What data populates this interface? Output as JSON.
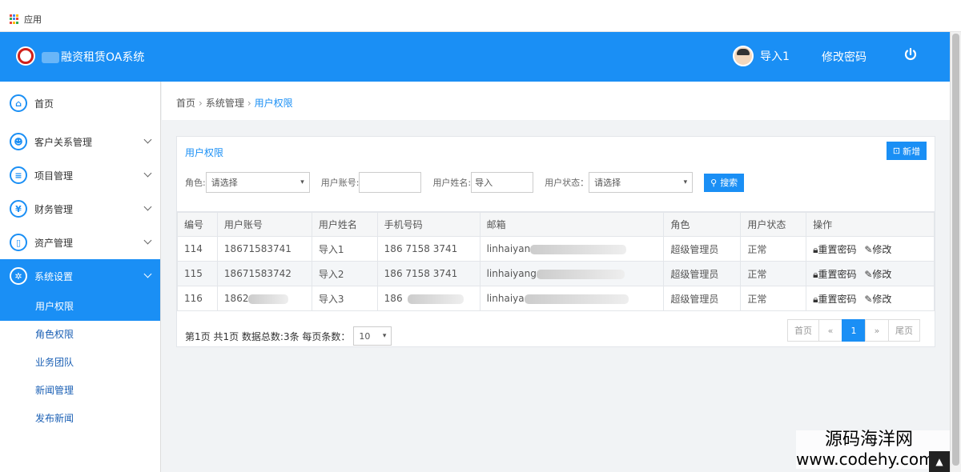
{
  "browser": {
    "apps_label": "应用"
  },
  "header": {
    "title": "融资租赁OA系统",
    "user_name": "导入1",
    "change_password": "修改密码"
  },
  "sidebar": {
    "items": [
      {
        "label": "首页",
        "icon": "home-icon"
      },
      {
        "label": "客户关系管理",
        "icon": "users-icon"
      },
      {
        "label": "项目管理",
        "icon": "list-icon"
      },
      {
        "label": "财务管理",
        "icon": "yen-icon"
      },
      {
        "label": "资产管理",
        "icon": "file-icon"
      },
      {
        "label": "系统设置",
        "icon": "gear-icon"
      }
    ],
    "sub_items": [
      "用户权限",
      "角色权限",
      "业务团队",
      "新闻管理",
      "发布新闻"
    ]
  },
  "breadcrumb": {
    "home": "首页",
    "parent": "系统管理",
    "current": "用户权限"
  },
  "panel": {
    "title": "用户权限",
    "add_label": "新增",
    "filters": {
      "role_label": "角色:",
      "role_value": "请选择",
      "account_label": "用户账号:",
      "account_value": "",
      "name_label": "用户姓名:",
      "name_value": "导入",
      "status_label": "用户状态：",
      "status_value": "请选择"
    },
    "search_label": "搜索"
  },
  "table": {
    "headers": [
      "编号",
      "用户账号",
      "用户姓名",
      "手机号码",
      "邮箱",
      "角色",
      "用户状态",
      "操作"
    ],
    "rows": [
      [
        "114",
        "18671583741",
        "导入1",
        "186 7158 3741",
        "linhaiyan",
        "超级管理员",
        "正常"
      ],
      [
        "115",
        "18671583742",
        "导入2",
        "186 7158 3741",
        "linhaiyang",
        "超级管理员",
        "正常"
      ],
      [
        "116",
        "1862",
        "导入3",
        "186",
        "linhaiya",
        "超级管理员",
        "正常"
      ]
    ],
    "action_reset": "重置密码",
    "action_edit": "修改"
  },
  "pagination": {
    "info": "第1页 共1页 数据总数:3条 每页条数：",
    "page_size": "10",
    "first": "首页",
    "prev": "«",
    "current": "1",
    "next": "»",
    "last": "尾页"
  },
  "watermark": {
    "line1": "源码海洋网",
    "line2": "www.codehy.com"
  },
  "colors": {
    "primary": "#1a8ff5"
  }
}
